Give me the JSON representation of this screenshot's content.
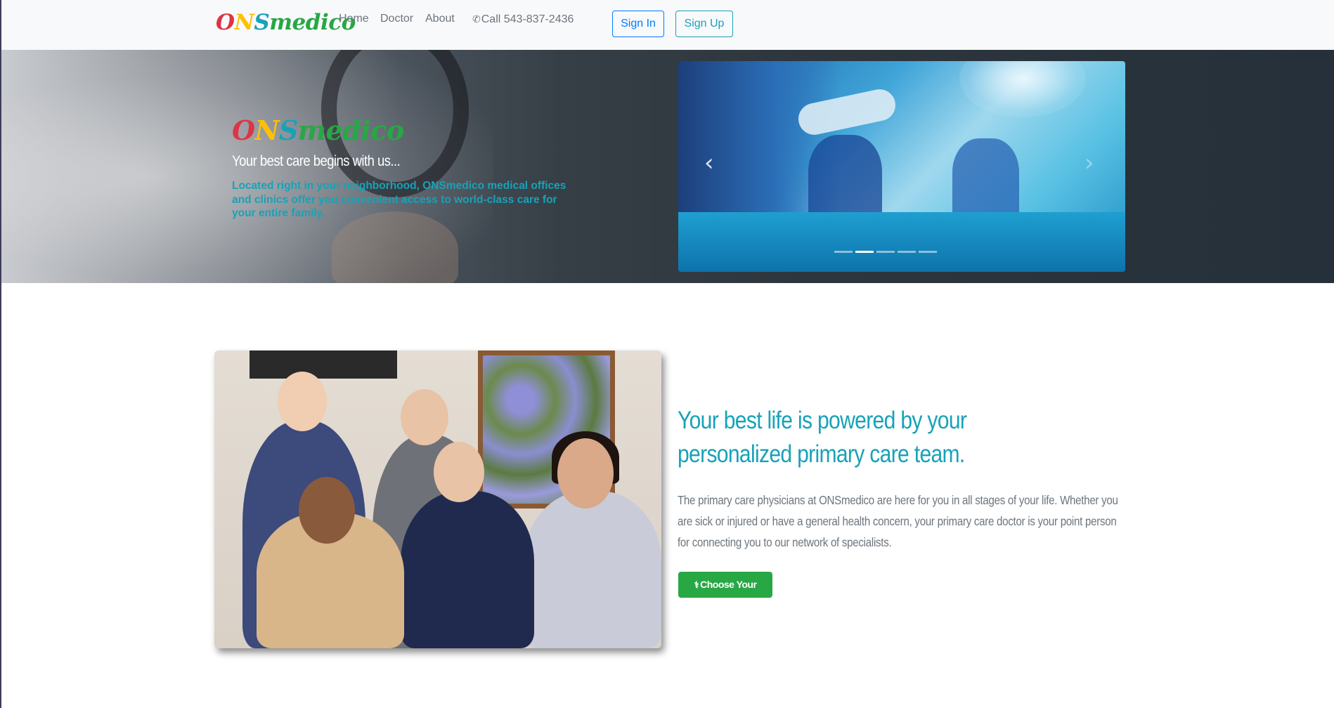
{
  "navbar": {
    "brand": [
      "O",
      "N",
      "S",
      "medico"
    ],
    "links": [
      "Home",
      "Doctor",
      "About"
    ],
    "phone_icon": "phone-icon",
    "phone": "Call 543-837-2436",
    "signin": "Sign In",
    "signup": "Sign Up"
  },
  "hero": {
    "logo": [
      "O",
      "N",
      "S",
      "medico"
    ],
    "tagline": "Your best care begins with us...",
    "description": "Located right in your neighborhood, ONSmedico medical offices and clinics offer you convenient access to world-class care for your entire family.",
    "carousel": {
      "prev": "‹",
      "next": "›",
      "slide_count": 5,
      "active_index": 1
    }
  },
  "promo": {
    "title": "Your best life is powered by your personalized primary care team.",
    "text": "The primary care physicians at ONSmedico are here for you in all stages of your life. Whether you are sick or injured or have a general health concern, your primary care doctor is your point person for connecting you to our network of specialists.",
    "button_icon": "doctor-icon",
    "button": "Choose Your Doctor"
  },
  "colors": {
    "brand_red": "#dc3545",
    "brand_yellow": "#ffc107",
    "brand_teal": "#17a2b8",
    "brand_green": "#28a745",
    "primary_blue": "#007bff"
  }
}
